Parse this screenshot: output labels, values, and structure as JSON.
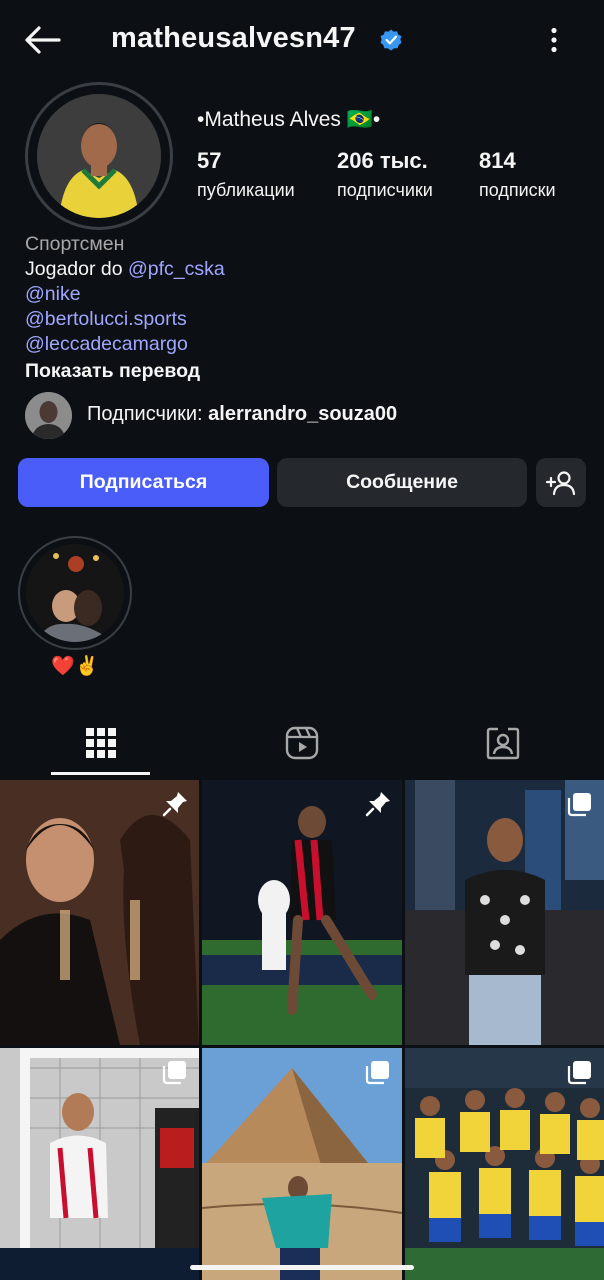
{
  "header": {
    "username": "matheusalvesn47",
    "back_icon": "arrow-left-icon",
    "verified_icon": "verified-badge-icon",
    "more_icon": "more-vertical-icon"
  },
  "profile": {
    "display_name": "•Matheus Alves 🇧🇷•",
    "stats": [
      {
        "value": "57",
        "label": "публикации"
      },
      {
        "value": "206 тыс.",
        "label": "подписчики"
      },
      {
        "value": "814",
        "label": "подписки"
      }
    ],
    "category": "Спортсмен",
    "bio_text": "Jogador do ",
    "mentions": [
      "pfc_cska",
      "nike",
      "bertolucci.sports",
      "leccadecamargo"
    ],
    "show_translation": "Показать перевод",
    "followed_by_prefix": "Подписчики: ",
    "followed_by_user": "alerrandro_souza00"
  },
  "actions": {
    "follow": "Подписаться",
    "message": "Сообщение",
    "add_icon": "add-person-icon"
  },
  "highlights": [
    {
      "label": "❤️✌️"
    }
  ],
  "tabs": [
    {
      "icon": "grid-icon",
      "active": true
    },
    {
      "icon": "reels-icon",
      "active": false
    },
    {
      "icon": "tagged-icon",
      "active": false
    }
  ],
  "colors": {
    "background": "#0c1014",
    "accent": "#4a5df9",
    "link": "#a1a6ff",
    "verified": "#3897f0",
    "secondary_button": "#25292e"
  },
  "posts": [
    {
      "badge": "pin-icon"
    },
    {
      "badge": "pin-icon"
    },
    {
      "badge": "carousel-icon"
    },
    {
      "badge": "carousel-icon"
    },
    {
      "badge": "carousel-icon"
    },
    {
      "badge": "carousel-icon"
    }
  ]
}
